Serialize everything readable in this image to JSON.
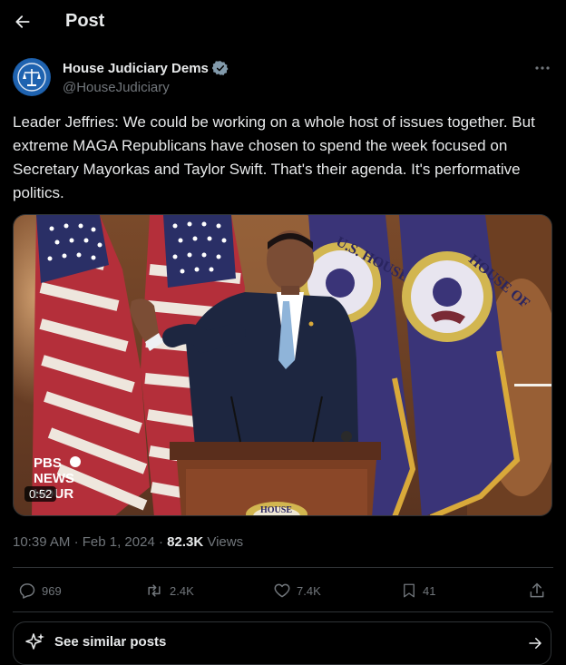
{
  "header": {
    "title": "Post"
  },
  "author": {
    "name": "House Judiciary Dems",
    "handle": "@HouseJudiciary"
  },
  "post": {
    "text": "Leader Jeffries: We could be working on a whole host of issues together. But extreme MAGA Republicans have chosen to spend the week focused on Secretary Mayorkas and Taylor Swift. That's their agenda. It's performative politics.",
    "video_duration": "0:52",
    "watermark": [
      "PBS",
      "NEWS",
      "HOUR"
    ],
    "seal_text": "U.S. HOUSE OF REPRESENTATIVES",
    "time": "10:39 AM",
    "date": "Feb 1, 2024",
    "views_count": "82.3K",
    "views_label": "Views"
  },
  "actions": {
    "replies": "969",
    "reposts": "2.4K",
    "likes": "7.4K",
    "bookmarks": "41"
  },
  "similar": {
    "label": "See similar posts"
  },
  "colors": {
    "background": "#000000",
    "text": "#e7e9ea",
    "muted": "#71767b",
    "border": "#2f3336",
    "verified": "#829aab"
  }
}
